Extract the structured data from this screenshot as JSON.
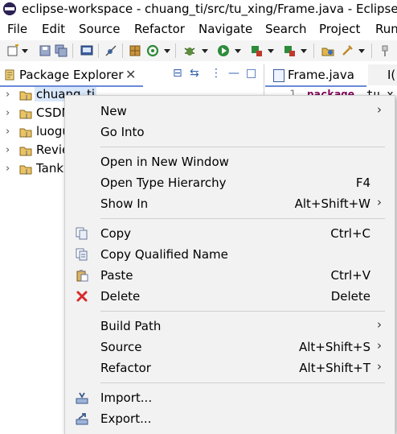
{
  "window": {
    "title": "eclipse-workspace - chuang_ti/src/tu_xing/Frame.java - Eclipse ID"
  },
  "menubar": [
    "File",
    "Edit",
    "Source",
    "Refactor",
    "Navigate",
    "Search",
    "Project",
    "Run"
  ],
  "toolbar_icons": [
    "new-icon",
    "save-icon",
    "save-all-icon",
    "terminal-icon",
    "skip-breakpoints-icon",
    "new-package-icon",
    "refresh-icon",
    "debug-icon",
    "run-icon",
    "run-coverage-icon",
    "external-tools-icon",
    "open-type-icon",
    "build-icon",
    "search-icon"
  ],
  "package_explorer": {
    "tab_label": "Package Explorer",
    "close_glyph": "✕",
    "tools": [
      "⊟",
      "⇆",
      "⋮",
      "—",
      "□"
    ],
    "projects": [
      {
        "label": "chuang_ti",
        "selected": true
      },
      {
        "label": "CSDN"
      },
      {
        "label": "luogu"
      },
      {
        "label": "Revie"
      },
      {
        "label": "Tank"
      }
    ]
  },
  "editor": {
    "active_tab": "Frame.java",
    "second_tab": "I(",
    "line_number": "1",
    "keyword": "package",
    "rest": "tu_x"
  },
  "context_menu": {
    "items": [
      {
        "label": "New",
        "submenu": true
      },
      {
        "label": "Go Into"
      },
      {
        "separator": true
      },
      {
        "label": "Open in New Window"
      },
      {
        "label": "Open Type Hierarchy",
        "shortcut": "F4"
      },
      {
        "label": "Show In",
        "shortcut": "Alt+Shift+W",
        "submenu": true
      },
      {
        "separator": true
      },
      {
        "label": "Copy",
        "shortcut": "Ctrl+C",
        "icon": "copy-icon"
      },
      {
        "label": "Copy Qualified Name",
        "icon": "copy-qualified-name-icon"
      },
      {
        "label": "Paste",
        "shortcut": "Ctrl+V",
        "icon": "paste-icon"
      },
      {
        "label": "Delete",
        "shortcut": "Delete",
        "icon": "delete-icon"
      },
      {
        "separator": true
      },
      {
        "label": "Build Path",
        "submenu": true
      },
      {
        "label": "Source",
        "shortcut": "Alt+Shift+S",
        "submenu": true
      },
      {
        "label": "Refactor",
        "shortcut": "Alt+Shift+T",
        "submenu": true
      },
      {
        "separator": true
      },
      {
        "label": "Import...",
        "icon": "import-icon"
      },
      {
        "label": "Export...",
        "icon": "export-icon"
      }
    ],
    "submenu_glyph": "›"
  },
  "colors": {
    "menu_bg": "#f2f2f2",
    "selection": "#d9e7fb",
    "tab_underline": "#6a8ad8",
    "delete_red": "#d62b2b",
    "keyword": "#7f0055"
  }
}
